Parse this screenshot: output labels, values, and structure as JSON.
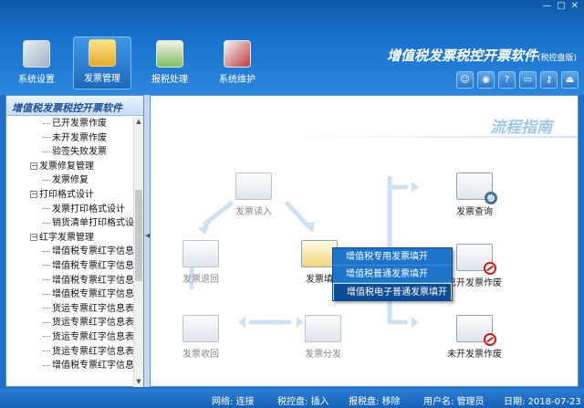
{
  "window": {
    "minimize": "—",
    "maximize": "□",
    "close": "✕"
  },
  "toolbar": {
    "buttons": [
      {
        "label": "系统设置",
        "icon": "settings-panel-icon",
        "active": false
      },
      {
        "label": "发票管理",
        "icon": "invoice-folder-icon",
        "active": true
      },
      {
        "label": "报税处理",
        "icon": "tax-report-icon",
        "active": false
      },
      {
        "label": "系统维护",
        "icon": "maintenance-tools-icon",
        "active": false
      }
    ],
    "app_title": "增值税发票税控开票软件",
    "app_subtitle": "(税控盘版)",
    "tool_icons": [
      "user-icon",
      "globe-icon",
      "help-icon",
      "window-icon",
      "key-icon",
      "exit-icon"
    ]
  },
  "sidebar": {
    "title": "增值税发票税控开票软件",
    "items": [
      {
        "label": "已开发票作废",
        "level": 2,
        "toggle": ""
      },
      {
        "label": "未开发票作废",
        "level": 2,
        "toggle": ""
      },
      {
        "label": "验签失败发票",
        "level": 2,
        "toggle": ""
      },
      {
        "label": "发票修复管理",
        "level": 1,
        "toggle": "−"
      },
      {
        "label": "发票修复",
        "level": 2,
        "toggle": ""
      },
      {
        "label": "打印格式设计",
        "level": 1,
        "toggle": "−"
      },
      {
        "label": "发票打印格式设计",
        "level": 2,
        "toggle": ""
      },
      {
        "label": "销货清单打印格式设",
        "level": 2,
        "toggle": ""
      },
      {
        "label": "红字发票管理",
        "level": 1,
        "toggle": "−"
      },
      {
        "label": "增值税专票红字信息",
        "level": 2,
        "toggle": ""
      },
      {
        "label": "增值税专票红字信息",
        "level": 2,
        "toggle": ""
      },
      {
        "label": "增值税专票红字信息",
        "level": 2,
        "toggle": ""
      },
      {
        "label": "增值税专票红字信息",
        "level": 2,
        "toggle": ""
      },
      {
        "label": "货运专票红字信息表",
        "level": 2,
        "toggle": ""
      },
      {
        "label": "货运专票红字信息表",
        "level": 2,
        "toggle": ""
      },
      {
        "label": "货运专票红字信息表",
        "level": 2,
        "toggle": ""
      },
      {
        "label": "货运专票红字信息表",
        "level": 2,
        "toggle": ""
      },
      {
        "label": "增值税专票红字信息",
        "level": 2,
        "toggle": ""
      }
    ]
  },
  "flow": {
    "title": "流程指南",
    "nodes": {
      "read": "发票读入",
      "return": "发票退回",
      "fill": "发票填",
      "distribute": "发票分发",
      "recover": "发票收回",
      "query": "发票查询",
      "void_issued": "已开发票作废",
      "void_unissued": "未开发票作废"
    }
  },
  "context_menu": {
    "items": [
      {
        "label": "增值税专用发票填开",
        "highlight": false
      },
      {
        "label": "增值税普通发票填开",
        "highlight": false
      },
      {
        "label": "增值税电子普通发票填开",
        "highlight": true
      }
    ]
  },
  "status": {
    "network_label": "网络:",
    "network_value": "连接",
    "tax_disk_label": "税控盘:",
    "tax_disk_value": "插入",
    "report_disk_label": "报税盘:",
    "report_disk_value": "移除",
    "user_label": "用户名:",
    "user_value": "管理员",
    "date_label": "日期:",
    "date_value": "2018-07-23"
  },
  "colors": {
    "header_blue": "#1a74cf",
    "status_blue": "#1662b7",
    "menu_blue": "#1d74c9",
    "badge_red": "#d01919"
  }
}
